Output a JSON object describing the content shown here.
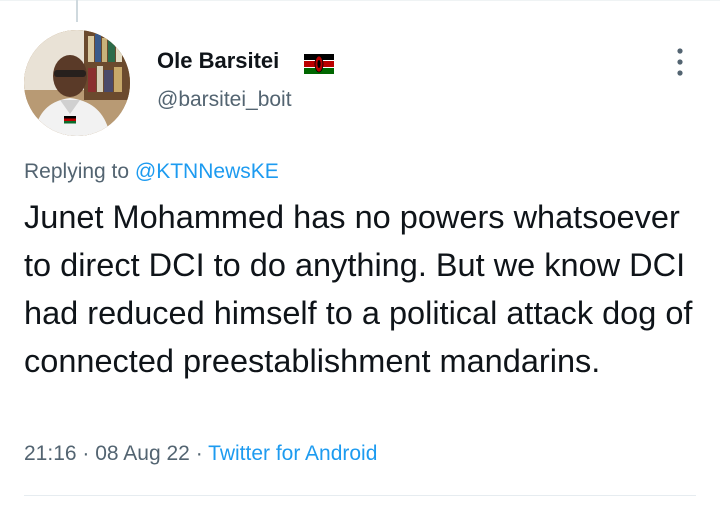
{
  "tweet": {
    "author": {
      "display_name": "Ole Barsitei",
      "handle": "@barsitei_boit",
      "flag_icon": "kenya-flag-icon"
    },
    "reply_prefix": "Replying to",
    "reply_to": "@KTNNewsKE",
    "text": "Junet Mohammed has no powers whatsoever to direct DCI to do anything. But we know DCI had reduced himself to a political attack dog of connected preestablishment mandarins.",
    "time": "21:16",
    "separator": "·",
    "date": "08 Aug 22",
    "source": "Twitter for Android"
  },
  "colors": {
    "text": "#0f1419",
    "secondary": "#536471",
    "link": "#1d9bf0",
    "divider": "#e6ecf0"
  },
  "icons": [
    "more-options-icon",
    "kenya-flag-icon"
  ]
}
